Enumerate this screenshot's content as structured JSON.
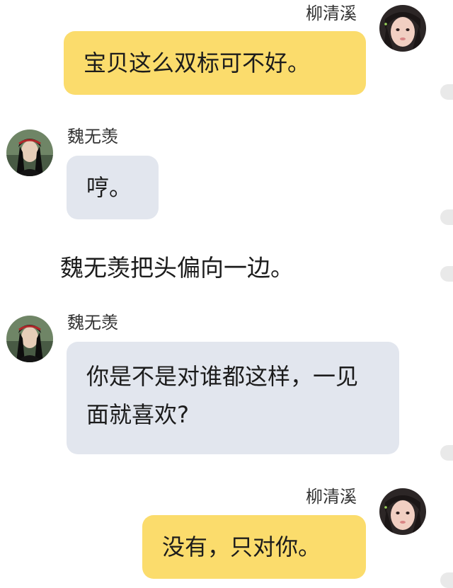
{
  "messages": [
    {
      "sender": "柳清溪",
      "side": "right",
      "text": "宝贝这么双标可不好。"
    },
    {
      "sender": "魏无羡",
      "side": "left",
      "text": "哼。"
    },
    {
      "narration": "魏无羡把头偏向一边。"
    },
    {
      "sender": "魏无羡",
      "side": "left",
      "text": "你是不是对谁都这样，一见面就喜欢?"
    },
    {
      "sender": "柳清溪",
      "side": "right",
      "text": "没有，只对你。"
    }
  ],
  "colors": {
    "right_bubble": "#fbdc6c",
    "left_bubble": "#e2e6ee",
    "background": "#ffffff"
  },
  "avatars": {
    "right": "avatar-liu-qingxi",
    "left": "avatar-wei-wuxian"
  }
}
